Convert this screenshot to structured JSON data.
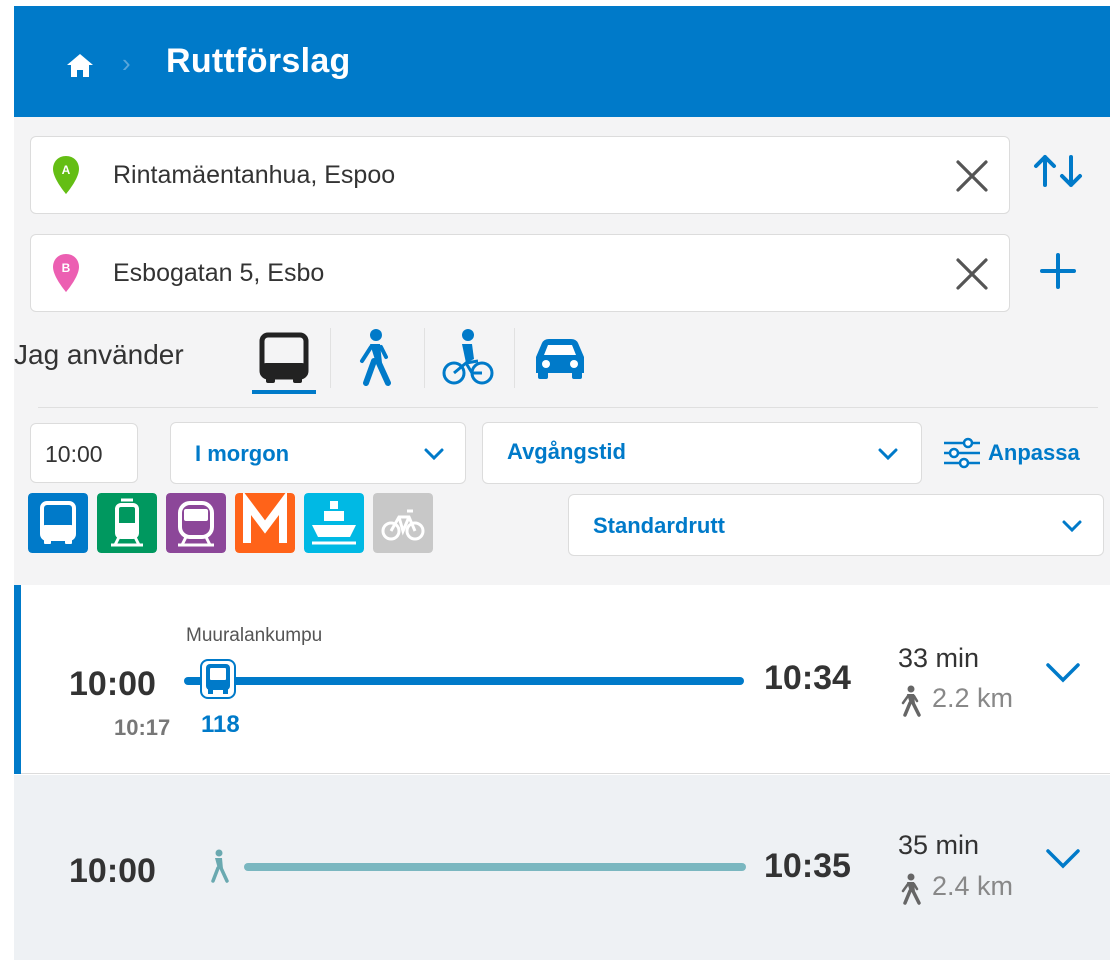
{
  "header": {
    "title": "Ruttförslag",
    "home_icon": "home-icon",
    "separator": "›"
  },
  "colors": {
    "brand": "#007ac9",
    "origin_pin": "#64be14",
    "destination_pin": "#ec5fb2",
    "bus": "#007ac9",
    "tram": "#00985f",
    "train": "#8c4799",
    "metro": "#ff6319",
    "ferry": "#00b9e4",
    "citybike_disabled": "#c8c8c8"
  },
  "origin": {
    "pin_letter": "A",
    "value": "Rintamäentanhua, Espoo"
  },
  "destination": {
    "pin_letter": "B",
    "value": "Esbogatan 5, Esbo"
  },
  "swap_icon": "swap-arrows-icon",
  "add_via_icon": "plus-icon",
  "modes": {
    "label": "Jag använder",
    "items": [
      "bus-icon",
      "walk-icon",
      "bike-icon",
      "car-icon"
    ],
    "selected": "bus-icon"
  },
  "time": {
    "value": "10:00",
    "day": "I morgon",
    "type": "Avgångstid",
    "customize": "Anpassa"
  },
  "transport_modes": [
    "bus",
    "tram",
    "train",
    "metro",
    "ferry",
    "citybike"
  ],
  "route_type": "Standardrutt",
  "routes": [
    {
      "start": "10:00",
      "end": "10:34",
      "stop": "Muuralankumpu",
      "departure": "10:17",
      "line": "118",
      "duration": "33 min",
      "walk_distance": "2.2 km"
    },
    {
      "start": "10:00",
      "end": "10:35",
      "duration": "35 min",
      "walk_distance": "2.4 km"
    }
  ]
}
